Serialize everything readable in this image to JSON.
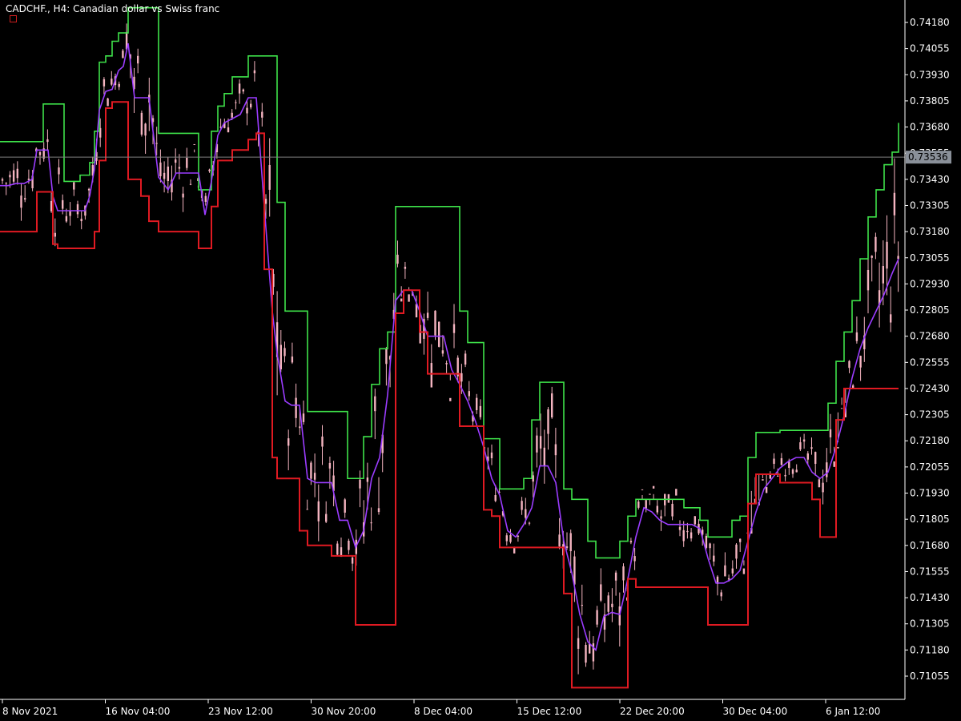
{
  "chart_title": "CADCHF., H4:  Canadian dollar vs Swiss franc",
  "current_price_label": "0.73536",
  "colors": {
    "background": "#000000",
    "axis": "#ffffff",
    "upper_channel": "#3ee24a",
    "lower_channel": "#e01a22",
    "middle_line": "#9b3cff",
    "candle": "#f4b4c0",
    "price_line": "#808080",
    "price_tag_bg": "#8a9099"
  },
  "chart_data": {
    "type": "line",
    "title": "CADCHF., H4:  Canadian dollar vs Swiss franc",
    "ylim": [
      0.7099,
      0.7424
    ],
    "y_ticks": [
      "0.74180",
      "0.74055",
      "0.73930",
      "0.73805",
      "0.73680",
      "0.73555",
      "0.73430",
      "0.73305",
      "0.73180",
      "0.73055",
      "0.72930",
      "0.72805",
      "0.72680",
      "0.72555",
      "0.72430",
      "0.72305",
      "0.72180",
      "0.72055",
      "0.71930",
      "0.71805",
      "0.71680",
      "0.71555",
      "0.71430",
      "0.71305",
      "0.71180",
      "0.71055"
    ],
    "x_ticks": [
      "8 Nov 2021",
      "16 Nov 04:00",
      "23 Nov 12:00",
      "30 Nov 20:00",
      "8 Dec 04:00",
      "15 Dec 12:00",
      "22 Dec 20:00",
      "30 Dec 04:00",
      "6 Jan 12:00"
    ],
    "current_price": 0.73536,
    "series": [
      {
        "role": "upper_channel",
        "x": [
          0,
          10,
          20,
          30,
          40,
          46,
          54,
          60,
          66,
          72,
          80,
          86,
          94,
          100,
          106,
          112,
          118,
          124,
          132,
          140,
          148,
          154,
          160,
          168,
          176,
          186,
          198,
          210,
          220,
          230,
          240,
          248,
          256,
          264,
          272,
          280,
          290,
          300,
          310,
          320,
          330,
          340,
          346,
          356,
          364,
          374,
          384,
          394,
          404,
          414,
          424,
          434,
          444,
          454,
          464,
          474,
          484,
          494,
          504,
          514,
          524,
          534,
          544,
          554,
          564,
          574,
          584,
          594,
          604,
          614,
          624,
          634,
          644,
          654,
          664,
          674,
          684,
          694,
          704,
          714,
          724,
          734,
          744,
          754,
          764,
          774,
          784,
          794,
          804,
          814,
          824,
          834,
          844,
          854,
          864,
          874,
          884,
          894,
          904,
          914,
          924,
          934,
          944,
          954,
          964,
          974,
          984,
          994,
          1004,
          1014,
          1024,
          1034,
          1044,
          1054,
          1064,
          1074,
          1084,
          1094,
          1104,
          1114,
          1122
        ],
        "y": [
          0.7361,
          0.7361,
          0.7361,
          0.7361,
          0.7361,
          0.7361,
          0.7379,
          0.7379,
          0.7379,
          0.7379,
          0.7342,
          0.7342,
          0.7342,
          0.7345,
          0.7345,
          0.7351,
          0.7366,
          0.7399,
          0.7402,
          0.7409,
          0.7413,
          0.7413,
          0.7425,
          0.7425,
          0.7425,
          0.7425,
          0.7365,
          0.7365,
          0.7365,
          0.7365,
          0.7365,
          0.7338,
          0.7338,
          0.7366,
          0.7378,
          0.7384,
          0.7392,
          0.7392,
          0.7402,
          0.7402,
          0.7402,
          0.7402,
          0.7332,
          0.728,
          0.728,
          0.728,
          0.7232,
          0.7232,
          0.7232,
          0.7232,
          0.7232,
          0.72,
          0.72,
          0.722,
          0.7245,
          0.7262,
          0.727,
          0.733,
          0.733,
          0.733,
          0.733,
          0.733,
          0.733,
          0.733,
          0.733,
          0.728,
          0.7265,
          0.7265,
          0.7219,
          0.7219,
          0.7195,
          0.7195,
          0.7195,
          0.72,
          0.7228,
          0.7246,
          0.7246,
          0.7246,
          0.7195,
          0.719,
          0.719,
          0.717,
          0.7162,
          0.7162,
          0.7162,
          0.717,
          0.7182,
          0.719,
          0.719,
          0.719,
          0.719,
          0.719,
          0.719,
          0.7186,
          0.7186,
          0.718,
          0.7172,
          0.7172,
          0.7172,
          0.718,
          0.7182,
          0.721,
          0.7222,
          0.7222,
          0.7222,
          0.7223,
          0.7223,
          0.7223,
          0.7223,
          0.7223,
          0.7223,
          0.7236,
          0.7256,
          0.727,
          0.7285,
          0.7305,
          0.7325,
          0.7338,
          0.735,
          0.7356,
          0.737
        ]
      },
      {
        "role": "middle_line",
        "x": [
          0,
          10,
          20,
          30,
          40,
          46,
          54,
          60,
          66,
          72,
          80,
          86,
          94,
          100,
          106,
          112,
          118,
          124,
          132,
          140,
          148,
          154,
          160,
          168,
          176,
          186,
          198,
          210,
          220,
          230,
          240,
          248,
          256,
          264,
          272,
          280,
          290,
          300,
          310,
          320,
          330,
          340,
          346,
          356,
          364,
          374,
          384,
          394,
          404,
          414,
          424,
          434,
          444,
          454,
          464,
          474,
          484,
          494,
          504,
          514,
          524,
          534,
          544,
          554,
          564,
          574,
          584,
          594,
          604,
          614,
          624,
          634,
          644,
          654,
          664,
          674,
          684,
          694,
          704,
          714,
          724,
          734,
          744,
          754,
          764,
          774,
          784,
          794,
          804,
          814,
          824,
          834,
          844,
          854,
          864,
          874,
          884,
          894,
          904,
          914,
          924,
          934,
          944,
          954,
          964,
          974,
          984,
          994,
          1004,
          1014,
          1024,
          1034,
          1044,
          1054,
          1064,
          1074,
          1084,
          1094,
          1104,
          1114,
          1122
        ],
        "y": [
          0.734,
          0.734,
          0.7341,
          0.7341,
          0.7343,
          0.7357,
          0.7357,
          0.7357,
          0.7335,
          0.7328,
          0.7328,
          0.7328,
          0.7328,
          0.7328,
          0.7328,
          0.7335,
          0.7348,
          0.7376,
          0.7385,
          0.7386,
          0.7395,
          0.7397,
          0.7408,
          0.7382,
          0.7382,
          0.7382,
          0.7344,
          0.7338,
          0.7346,
          0.7346,
          0.7346,
          0.7346,
          0.7326,
          0.7342,
          0.7364,
          0.737,
          0.7372,
          0.7374,
          0.7382,
          0.7382,
          0.733,
          0.728,
          0.726,
          0.7237,
          0.7235,
          0.7235,
          0.72,
          0.7198,
          0.7198,
          0.7198,
          0.718,
          0.718,
          0.7167,
          0.7175,
          0.72,
          0.721,
          0.724,
          0.7285,
          0.729,
          0.729,
          0.728,
          0.7268,
          0.7268,
          0.7268,
          0.7252,
          0.7245,
          0.7237,
          0.7227,
          0.7215,
          0.72,
          0.7192,
          0.7175,
          0.7172,
          0.7178,
          0.7186,
          0.7206,
          0.7206,
          0.7198,
          0.717,
          0.7155,
          0.7135,
          0.7122,
          0.7118,
          0.7134,
          0.7136,
          0.7135,
          0.7152,
          0.7172,
          0.7186,
          0.7184,
          0.718,
          0.7178,
          0.7178,
          0.7178,
          0.7178,
          0.7176,
          0.7162,
          0.715,
          0.715,
          0.7152,
          0.7156,
          0.717,
          0.7184,
          0.7195,
          0.72,
          0.7205,
          0.7208,
          0.721,
          0.721,
          0.7203,
          0.72,
          0.7203,
          0.7215,
          0.723,
          0.7248,
          0.7262,
          0.7272,
          0.728,
          0.7288,
          0.7298,
          0.7305
        ]
      },
      {
        "role": "lower_channel",
        "x": [
          0,
          10,
          20,
          30,
          40,
          46,
          54,
          60,
          66,
          72,
          80,
          86,
          94,
          100,
          106,
          112,
          118,
          124,
          132,
          140,
          148,
          154,
          160,
          168,
          176,
          186,
          198,
          210,
          220,
          230,
          240,
          248,
          256,
          264,
          272,
          280,
          290,
          300,
          310,
          320,
          330,
          340,
          346,
          356,
          364,
          374,
          384,
          394,
          404,
          414,
          424,
          434,
          444,
          454,
          464,
          474,
          484,
          494,
          504,
          514,
          524,
          534,
          544,
          554,
          564,
          574,
          584,
          594,
          604,
          614,
          624,
          634,
          644,
          654,
          664,
          674,
          684,
          694,
          704,
          714,
          724,
          734,
          744,
          754,
          764,
          774,
          784,
          794,
          804,
          814,
          824,
          834,
          844,
          854,
          864,
          874,
          884,
          894,
          904,
          914,
          924,
          934,
          944,
          954,
          964,
          974,
          984,
          994,
          1004,
          1014,
          1024,
          1034,
          1044,
          1054,
          1064,
          1074,
          1084,
          1094,
          1104,
          1114,
          1122
        ],
        "y": [
          0.7318,
          0.7318,
          0.7318,
          0.7318,
          0.7318,
          0.7337,
          0.7337,
          0.7337,
          0.7312,
          0.731,
          0.731,
          0.731,
          0.731,
          0.731,
          0.731,
          0.731,
          0.7318,
          0.7352,
          0.7377,
          0.738,
          0.738,
          0.738,
          0.7343,
          0.7343,
          0.7335,
          0.7323,
          0.7318,
          0.7318,
          0.7318,
          0.7318,
          0.7318,
          0.731,
          0.731,
          0.733,
          0.7352,
          0.7352,
          0.7357,
          0.7357,
          0.7362,
          0.7365,
          0.73,
          0.721,
          0.72,
          0.72,
          0.72,
          0.7175,
          0.7168,
          0.7168,
          0.7168,
          0.7163,
          0.7163,
          0.7163,
          0.713,
          0.713,
          0.713,
          0.713,
          0.713,
          0.7279,
          0.729,
          0.729,
          0.727,
          0.725,
          0.725,
          0.725,
          0.725,
          0.7225,
          0.7225,
          0.7225,
          0.7185,
          0.7182,
          0.7167,
          0.7167,
          0.7167,
          0.7167,
          0.7167,
          0.7167,
          0.7167,
          0.7167,
          0.7145,
          0.71,
          0.71,
          0.71,
          0.71,
          0.71,
          0.71,
          0.71,
          0.7152,
          0.7148,
          0.7148,
          0.7148,
          0.7148,
          0.7148,
          0.7148,
          0.7148,
          0.7148,
          0.7148,
          0.713,
          0.713,
          0.713,
          0.713,
          0.713,
          0.7188,
          0.7202,
          0.7202,
          0.7202,
          0.7198,
          0.7198,
          0.7198,
          0.7198,
          0.719,
          0.7172,
          0.7172,
          0.7228,
          0.7243,
          0.7243,
          0.7243,
          0.7243,
          0.7243,
          0.7243,
          0.7243,
          0.7243
        ]
      }
    ]
  }
}
